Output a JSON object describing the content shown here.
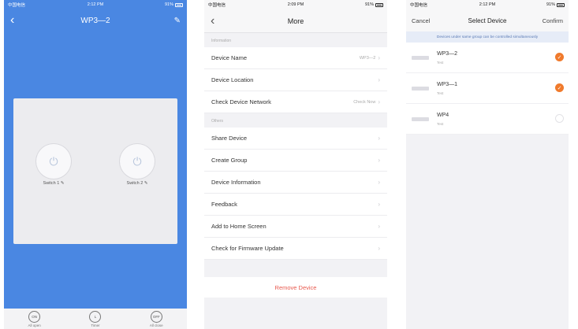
{
  "screen1": {
    "status": {
      "carrier": "中国电信",
      "time": "2:12 PM",
      "battery": "91%"
    },
    "title": "WP3—2",
    "switches": [
      {
        "label": "Switch 1"
      },
      {
        "label": "Switch 2"
      }
    ],
    "bottom": [
      {
        "icon": "ON",
        "label": "All open"
      },
      {
        "icon": "L",
        "label": "Timer"
      },
      {
        "icon": "OFF",
        "label": "All close"
      }
    ]
  },
  "screen2": {
    "status": {
      "carrier": "中国电信",
      "time": "2:09 PM",
      "battery": "91%"
    },
    "title": "More",
    "sections": [
      {
        "header": "Information",
        "rows": [
          {
            "label": "Device Name",
            "value": "WP3—2"
          },
          {
            "label": "Device Location",
            "value": ""
          },
          {
            "label": "Check Device Network",
            "value": "Check Now"
          }
        ]
      },
      {
        "header": "Others",
        "rows": [
          {
            "label": "Share Device",
            "value": ""
          },
          {
            "label": "Create Group",
            "value": ""
          },
          {
            "label": "Device Information",
            "value": ""
          },
          {
            "label": "Feedback",
            "value": ""
          },
          {
            "label": "Add to Home Screen",
            "value": ""
          },
          {
            "label": "Check for Firmware Update",
            "value": ""
          }
        ]
      }
    ],
    "remove": "Remove Device"
  },
  "screen3": {
    "status": {
      "carrier": "中国电信",
      "time": "2:12 PM",
      "battery": "91%"
    },
    "cancel": "Cancel",
    "title": "Select Device",
    "confirm": "Confirm",
    "notice": "Devices under same group can be controlled simultaneously",
    "devices": [
      {
        "name": "WP3—2",
        "sub": "Test",
        "selected": true
      },
      {
        "name": "WP3—1",
        "sub": "Test",
        "selected": true
      },
      {
        "name": "WP4",
        "sub": "Test",
        "selected": false
      }
    ]
  },
  "colors": {
    "brand_blue": "#4a87e2",
    "accent_orange": "#f07a2c",
    "danger_red": "#e85a4f"
  }
}
